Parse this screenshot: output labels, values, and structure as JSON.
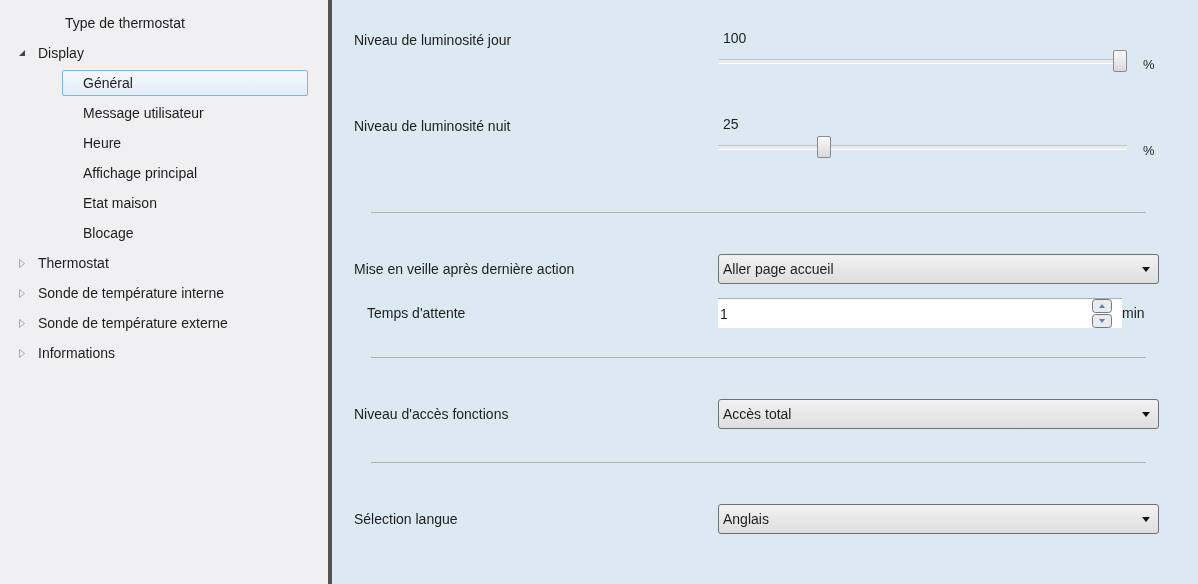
{
  "sidebar": {
    "items": [
      {
        "label": "Type de thermostat"
      },
      {
        "label": "Display",
        "expanded": true,
        "children": [
          {
            "label": "Général",
            "selected": true
          },
          {
            "label": "Message utilisateur",
            "selected": false
          },
          {
            "label": "Heure",
            "selected": false
          },
          {
            "label": "Affichage principal",
            "selected": false
          },
          {
            "label": "Etat maison",
            "selected": false
          },
          {
            "label": "Blocage",
            "selected": false
          }
        ]
      },
      {
        "label": "Thermostat",
        "expanded": false
      },
      {
        "label": "Sonde de température interne",
        "expanded": false
      },
      {
        "label": "Sonde de température externe",
        "expanded": false
      },
      {
        "label": "Informations",
        "expanded": false
      }
    ]
  },
  "settings": [
    {
      "kind": "slider",
      "label": "Niveau de luminosité jour",
      "value": "100",
      "level": 1.0,
      "unit": "%"
    },
    {
      "kind": "slider",
      "label": "Niveau de luminosité nuit",
      "value": "25",
      "level": 0.25,
      "unit": "%"
    },
    {
      "kind": "separator"
    },
    {
      "kind": "dropdown",
      "label": "Mise en veille après dernière action",
      "value": "Aller page accueil"
    },
    {
      "kind": "spin",
      "label": "Temps d'attente",
      "value": "1",
      "unit": "min"
    },
    {
      "kind": "separator"
    },
    {
      "kind": "dropdown",
      "label": "Niveau d'accès fonctions",
      "value": "Accès total"
    },
    {
      "kind": "separator"
    },
    {
      "kind": "dropdown",
      "label": "Sélection langue",
      "value": "Anglais"
    }
  ]
}
